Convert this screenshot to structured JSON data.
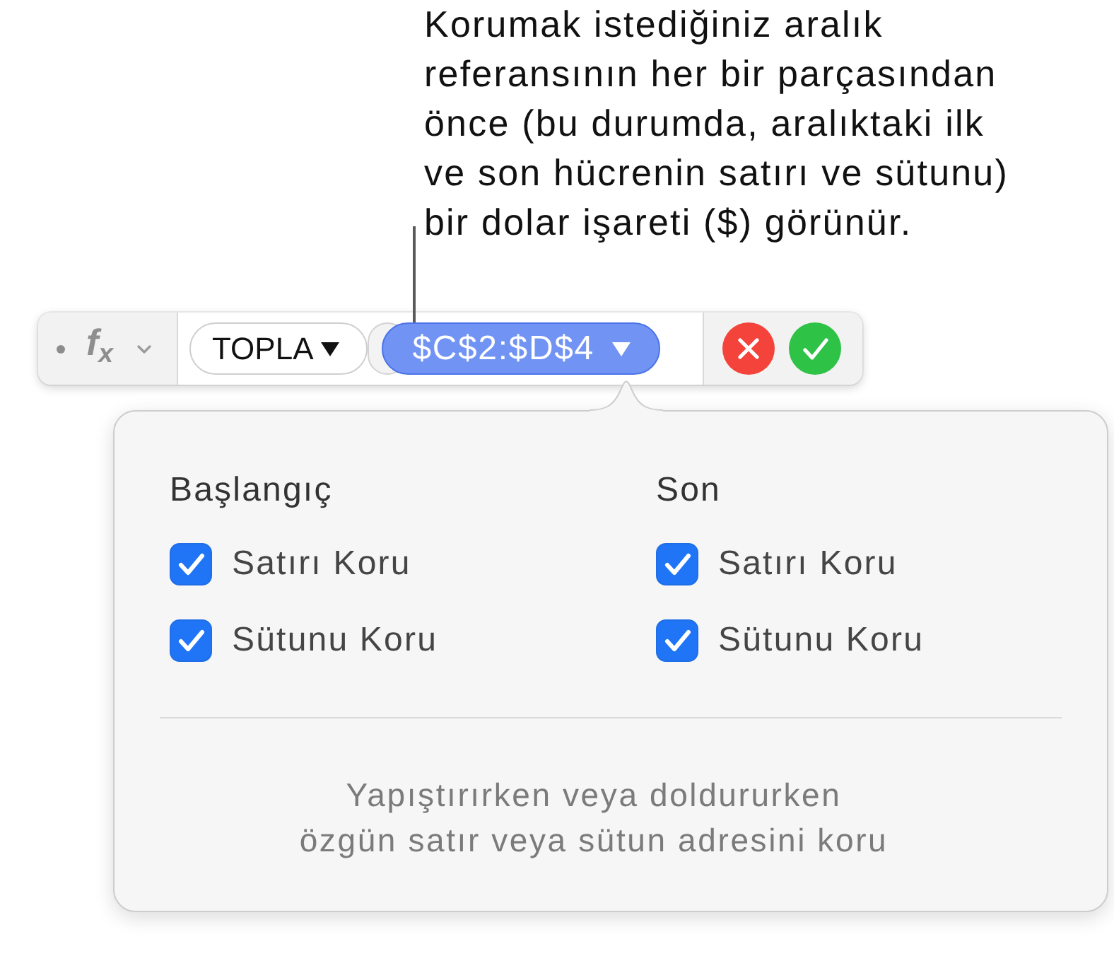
{
  "callout": {
    "lines": [
      "Korumak istediğiniz aralık",
      "referansının her bir parçasından",
      "önce (bu durumda, aralıktaki ilk",
      "ve son hücrenin satırı ve sütunu)",
      "bir dolar işareti ($) görünür."
    ]
  },
  "formula_bar": {
    "function_label": "f$_{x}$",
    "tokens": [
      {
        "text": "TOPLA",
        "selected": false
      },
      {
        "text": "$C$2:$D$4",
        "selected": true
      }
    ]
  },
  "popover": {
    "sections": [
      {
        "heading": "Başlangıç",
        "options": [
          {
            "label": "Satırı Koru",
            "checked": true
          },
          {
            "label": "Sütunu Koru",
            "checked": true
          }
        ]
      },
      {
        "heading": "Son",
        "options": [
          {
            "label": "Satırı Koru",
            "checked": true
          },
          {
            "label": "Sütunu Koru",
            "checked": true
          }
        ]
      }
    ],
    "note_lines": [
      "Yapıştırırken veya doldururken",
      "özgün satır veya sütun adresini koru"
    ]
  }
}
